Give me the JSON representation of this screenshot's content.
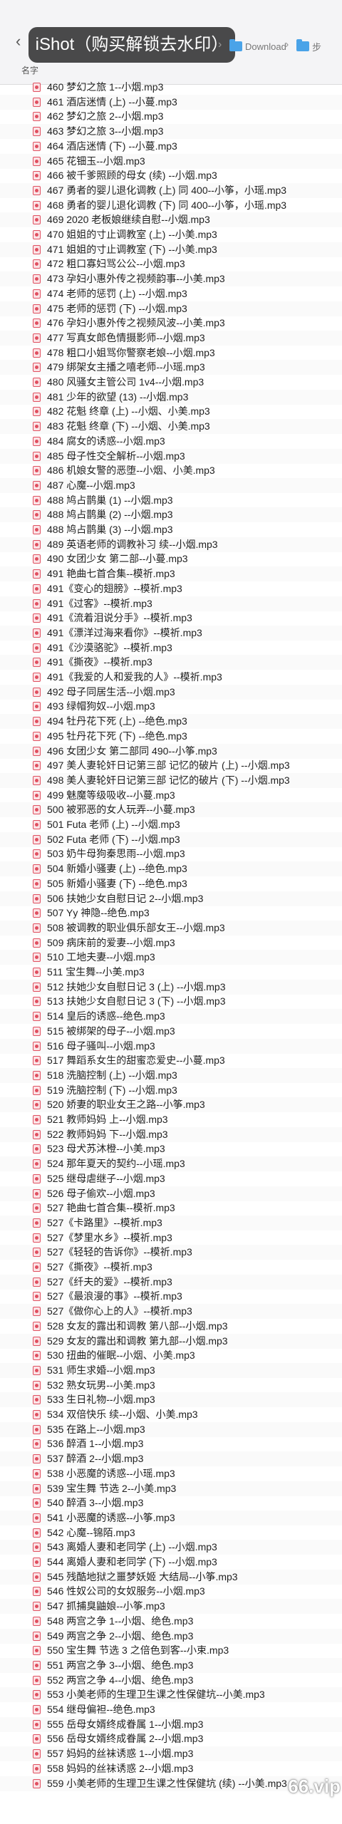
{
  "window": {
    "overlay_text": "iShot（购买解锁去水印）",
    "breadcrumb_folder1": "Download",
    "breadcrumb_folder2": "步"
  },
  "header": {
    "name_column": "名字"
  },
  "watermark": "66.vip",
  "files": [
    "460 梦幻之旅 1--小烟.mp3",
    "461 酒店迷情 (上) --小蔓.mp3",
    "462 梦幻之旅 2--小烟.mp3",
    "463 梦幻之旅 3--小烟.mp3",
    "464 酒店迷情 (下) --小蔓.mp3",
    "465 花钿玉--小烟.mp3",
    "466 被千爹照顾的母女 (续) --小烟.mp3",
    "467 勇者的婴儿退化调教 (上) 同 400--小筝，小瑶.mp3",
    "468 勇者的婴儿退化调教 (下) 同 400--小筝，小瑶.mp3",
    "469 2020 老板娘继续自慰--小烟.mp3",
    "470 姐姐的寸止调教室 (上) --小美.mp3",
    "471 姐姐的寸止调教室 (下) --小美.mp3",
    "472 粗口寡妇骂公公--小烟.mp3",
    "473 孕妇小惠外传之视频韵事--小美.mp3",
    "474 老师的惩罚 (上) --小烟.mp3",
    "475 老师的惩罚 (下) --小烟.mp3",
    "476 孕妇小惠外传之视频风波--小美.mp3",
    "477 写真女郎色情摄影师--小烟.mp3",
    "478 粗口小姐骂你警察老娘--小烟.mp3",
    "479 绑架女主播之嘻老师--小瑶.mp3",
    "480 风骚女主管公司 1v4--小烟.mp3",
    "481 少年的欲望 (13) --小烟.mp3",
    "482 花魁 终章 (上) --小烟、小美.mp3",
    "483 花魁 终章 (下) --小烟、小美.mp3",
    "484 腐女的诱惑--小烟.mp3",
    "485 母子性交全解析--小烟.mp3",
    "486 机娘女警的恶堕--小烟、小美.mp3",
    "487 心魔--小烟.mp3",
    "488 鸠占鹊巢 (1) --小烟.mp3",
    "488 鸠占鹊巢 (2) --小烟.mp3",
    "488 鸠占鹊巢 (3) --小烟.mp3",
    "489 英语老师的调教补习 续--小烟.mp3",
    "490 女团少女 第二部--小蔓.mp3",
    "491 艳曲七首合集--模祈.mp3",
    "491《变心的翅膀》--模祈.mp3",
    "491《过客》--模祈.mp3",
    "491《流着泪说分手》--模祈.mp3",
    "491《漂洋过海来看你》--模祈.mp3",
    "491《沙漠骆驼》--模祈.mp3",
    "491《撕夜》--模祈.mp3",
    "491《我爱的人和爱我的人》--模祈.mp3",
    "492 母子同居生活--小烟.mp3",
    "493 绿帽狗奴--小烟.mp3",
    "494 牡丹花下死 (上) --绝色.mp3",
    "495 牡丹花下死 (下) --绝色.mp3",
    "496 女团少女 第二部同 490--小筝.mp3",
    "497 美人妻轮奸日记第三部 记忆的破片 (上) --小烟.mp3",
    "498 美人妻轮奸日记第三部 记忆的破片 (下) --小烟.mp3",
    "499 魅魔等级吸收--小蔓.mp3",
    "500 被邪恶的女人玩弄--小蔓.mp3",
    "501 Futa 老师 (上) --小烟.mp3",
    "502 Futa 老师 (下) --小烟.mp3",
    "503 奶牛母狗秦思雨--小烟.mp3",
    "504 新婚小骚妻 (上) --绝色.mp3",
    "505 新婚小骚妻 (下) --绝色.mp3",
    "506 扶她少女自慰日记 2--小烟.mp3",
    "507 Yy 神隐--绝色.mp3",
    "508 被调教的职业俱乐部女王--小烟.mp3",
    "509 病床前的爱妻--小烟.mp3",
    "510 工地夫妻--小烟.mp3",
    "511 宝生舞--小美.mp3",
    "512 扶她少女自慰日记 3 (上) --小烟.mp3",
    "513 扶她少女自慰日记 3 (下) --小烟.mp3",
    "514 皇后的诱惑--绝色.mp3",
    "515 被绑架的母子--小烟.mp3",
    "516 母子骚叫--小烟.mp3",
    "517 舞蹈系女生的甜蜜恋爱史--小蔓.mp3",
    "518 洗脑控制 (上) --小烟.mp3",
    "519 洗脑控制 (下) --小烟.mp3",
    "520 娇妻的职业女王之路--小筝.mp3",
    "521 教师妈妈 上--小烟.mp3",
    "522 教师妈妈 下--小烟.mp3",
    "523 母犬苏沐橙--小美.mp3",
    "524 那年夏天的契约--小瑶.mp3",
    "525 继母虐继子--小烟.mp3",
    "526 母子偷欢--小烟.mp3",
    "527 艳曲七首合集--模祈.mp3",
    "527《卡路里》--模祈.mp3",
    "527《梦里水乡》--模祈.mp3",
    "527《轻轻的告诉你》--模祈.mp3",
    "527《撕夜》--模祈.mp3",
    "527《纤夫的爱》--模祈.mp3",
    "527《最浪漫的事》--模祈.mp3",
    "527《做你心上的人》--模祈.mp3",
    "528 女友的露出和调教 第八部--小烟.mp3",
    "529 女友的露出和调教 第九部--小烟.mp3",
    "530 扭曲的催眠--小烟、小美.mp3",
    "531 师生求婚--小烟.mp3",
    "532 熟女玩男--小美.mp3",
    "533 生日礼物--小烟.mp3",
    "534 双倍快乐 续--小烟、小美.mp3",
    "535 在路上--小烟.mp3",
    "536 醉酒 1--小烟.mp3",
    "537 醉酒 2--小烟.mp3",
    "538 小恶魔的诱惑--小瑶.mp3",
    "539 宝生舞 节选 2--小美.mp3",
    "540 醉酒 3--小烟.mp3",
    "541 小恶魔的诱惑--小筝.mp3",
    "542 心魔--锦陌.mp3",
    "543 离婚人妻和老同学 (上) --小烟.mp3",
    "544 离婚人妻和老同学 (下) --小烟.mp3",
    "545 残酷地狱之噩梦妖姬 大结局--小筝.mp3",
    "546 性奴公司的女奴服务--小烟.mp3",
    "547 抓捕臭鼬娘--小筝.mp3",
    "548 两宫之争 1--小烟、绝色.mp3",
    "549 两宫之争 2--小烟、绝色.mp3",
    "550 宝生舞 节选 3 之倍色到客--小束.mp3",
    "551 两宫之争 3--小烟、绝色.mp3",
    "552 两宫之争 4--小烟、绝色.mp3",
    "553 小美老师的生理卫生课之性保健坑--小美.mp3",
    "554 继母偏袒--绝色.mp3",
    "555 岳母女婿终成眷属 1--小烟.mp3",
    "556 岳母女婿终成眷属 2--小烟.mp3",
    "557 妈妈的丝袜诱惑 1--小烟.mp3",
    "558 妈妈的丝袜诱惑 2--小烟.mp3",
    "559 小美老师的生理卫生课之性保健坑 (续) --小美.mp3"
  ]
}
